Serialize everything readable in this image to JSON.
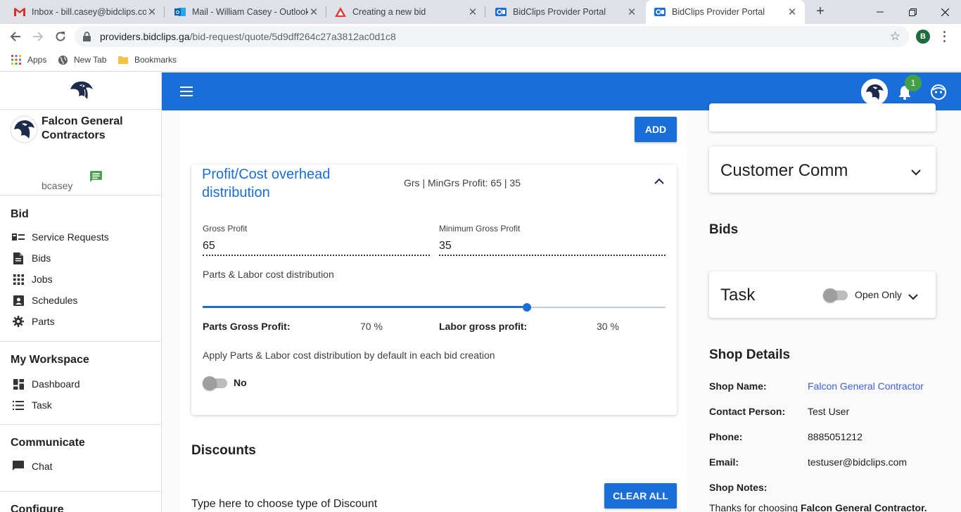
{
  "browser": {
    "tabs": [
      {
        "title": "Inbox - bill.casey@bidclips.com",
        "icon": "gmail-icon"
      },
      {
        "title": "Mail - William Casey - Outlook",
        "icon": "outlook-icon"
      },
      {
        "title": "Creating a new bid",
        "icon": "bid-icon"
      },
      {
        "title": "BidClips Provider Portal",
        "icon": "bidclips-icon"
      },
      {
        "title": "BidClips Provider Portal",
        "icon": "bidclips-icon",
        "active": true
      }
    ],
    "url_host": "providers.bidclips.ga",
    "url_path": "/bid-request/quote/5d9dff264c27a3812ac0d1c8",
    "profile_initial": "B",
    "bookmarks": [
      "Apps",
      "New Tab",
      "Bookmarks"
    ]
  },
  "sidebar": {
    "company": "Falcon General Contractors",
    "username": "bcasey",
    "sections": [
      {
        "heading": "Bid",
        "items": [
          {
            "label": "Service Requests",
            "icon": "service-requests-icon"
          },
          {
            "label": "Bids",
            "icon": "document-icon"
          },
          {
            "label": "Jobs",
            "icon": "grid-icon"
          },
          {
            "label": "Schedules",
            "icon": "schedule-icon"
          },
          {
            "label": "Parts",
            "icon": "gear-icon"
          }
        ]
      },
      {
        "heading": "My Workspace",
        "items": [
          {
            "label": "Dashboard",
            "icon": "dashboard-icon"
          },
          {
            "label": "Task",
            "icon": "list-icon"
          }
        ]
      },
      {
        "heading": "Communicate",
        "items": [
          {
            "label": "Chat",
            "icon": "chat-icon"
          }
        ]
      },
      {
        "heading": "Configure",
        "items": []
      }
    ]
  },
  "appbar": {
    "notification_count": "1"
  },
  "main": {
    "add_label": "ADD",
    "panel": {
      "title": "Profit/Cost overhead distribution",
      "summary": "Grs | MinGrs Profit: 65 | 35",
      "gross_profit_label": "Gross Profit",
      "gross_profit_value": "65",
      "min_gross_profit_label": "Minimum Gross Profit",
      "min_gross_profit_value": "35",
      "distribution_label": "Parts & Labor cost distribution",
      "parts_fraction": 0.7,
      "parts_label": "Parts Gross Profit:",
      "parts_value": "70 %",
      "labor_label": "Labor gross profit:",
      "labor_value": "30 %",
      "apply_text": "Apply Parts & Labor cost distribution by default in each bid creation",
      "apply_toggle_text": "No"
    },
    "discounts_title": "Discounts",
    "clear_all_label": "CLEAR ALL",
    "discount_placeholder": "Type here to choose type of Discount"
  },
  "right": {
    "customer_comm_title": "Customer Comm",
    "bids_heading": "Bids",
    "task_title": "Task",
    "task_toggle_text": "Open Only",
    "shop_heading": "Shop Details",
    "shop": {
      "name_key": "Shop Name:",
      "name_val": "Falcon General Contractor",
      "contact_key": "Contact Person:",
      "contact_val": "Test User",
      "phone_key": "Phone:",
      "phone_val": "8885051212",
      "email_key": "Email:",
      "email_val": "testuser@bidclips.com",
      "notes_key": "Shop Notes:",
      "notes_prefix": "Thanks for choosing ",
      "notes_bold": "Falcon General Contractor."
    }
  },
  "colors": {
    "primary": "#1a6ed8",
    "badge": "#43a047",
    "link": "#3b63d6"
  }
}
